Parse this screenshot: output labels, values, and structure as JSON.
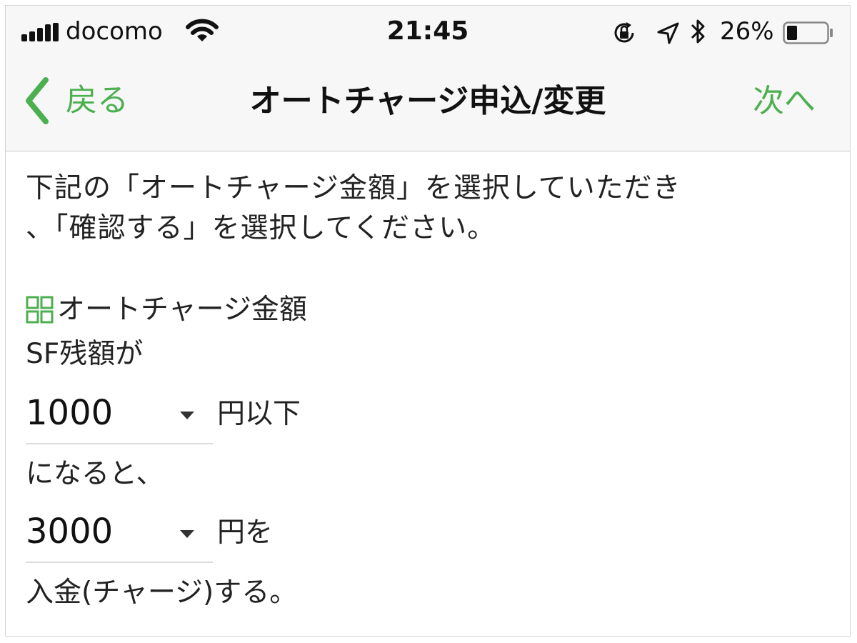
{
  "status_bar": {
    "carrier": "docomo",
    "time": "21:45",
    "battery_percent": "26%",
    "battery_level": 0.26
  },
  "nav": {
    "back_label": "戻る",
    "title": "オートチャージ申込/変更",
    "next_label": "次へ"
  },
  "content": {
    "instruction_line1": "下記の「オートチャージ金額」を選択していただき",
    "instruction_line2": "、「確認する」を選択してください。",
    "section_label": "オートチャージ金額",
    "sf_label": "SF残額が",
    "threshold": {
      "value": "1000",
      "suffix": "円以下"
    },
    "middle_text": "になると、",
    "charge_amount": {
      "value": "3000",
      "suffix": "円を"
    },
    "closing_text": "入金(チャージ)する。"
  },
  "colors": {
    "accent": "#4caf50",
    "text": "#222222",
    "navbar_bg": "#f7f7f7"
  },
  "icons": {
    "back": "chevron-left-icon",
    "section": "grid-icon",
    "dropdown": "caret-down-icon"
  }
}
